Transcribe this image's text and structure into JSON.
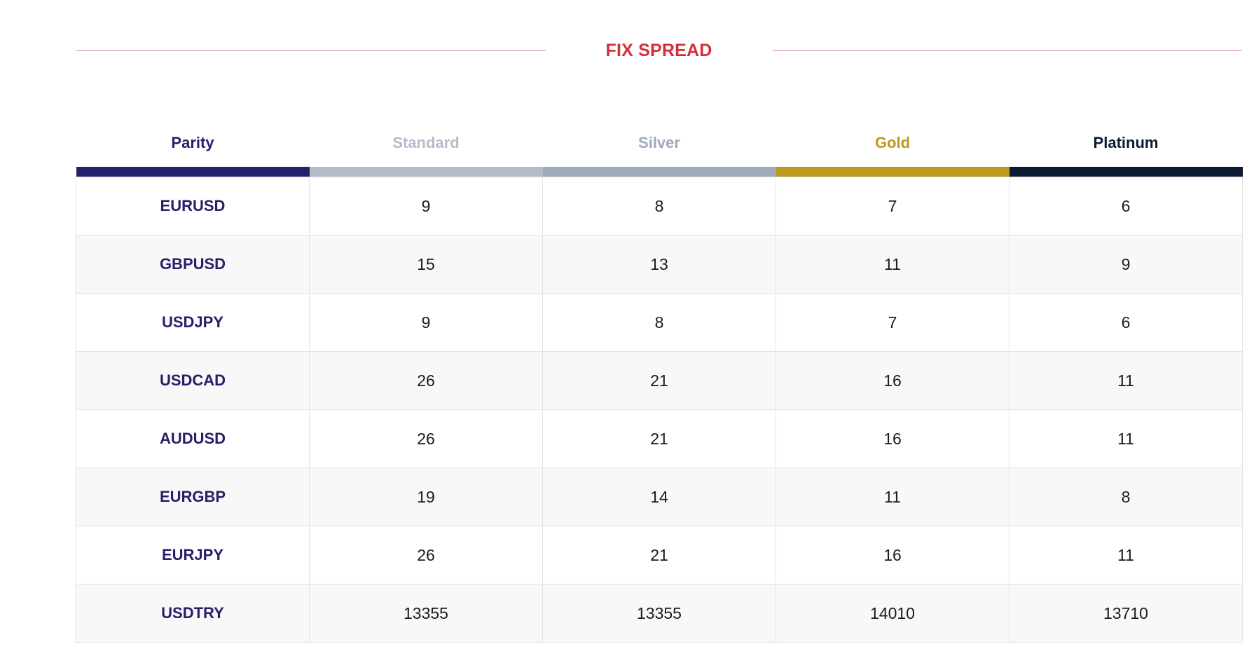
{
  "title": "FIX SPREAD",
  "colors": {
    "accent": "#d32f3a",
    "parity": "#26206a",
    "standard": "#b3bcc9",
    "silver": "#9ea9ba",
    "gold": "#bb9a1e",
    "platinum": "#0d1a33"
  },
  "table": {
    "headers": [
      "Parity",
      "Standard",
      "Silver",
      "Gold",
      "Platinum"
    ],
    "rows": [
      [
        "EURUSD",
        "9",
        "8",
        "7",
        "6"
      ],
      [
        "GBPUSD",
        "15",
        "13",
        "11",
        "9"
      ],
      [
        "USDJPY",
        "9",
        "8",
        "7",
        "6"
      ],
      [
        "USDCAD",
        "26",
        "21",
        "16",
        "11"
      ],
      [
        "AUDUSD",
        "26",
        "21",
        "16",
        "11"
      ],
      [
        "EURGBP",
        "19",
        "14",
        "11",
        "8"
      ],
      [
        "EURJPY",
        "26",
        "21",
        "16",
        "11"
      ],
      [
        "USDTRY",
        "13355",
        "13355",
        "14010",
        "13710"
      ]
    ]
  }
}
